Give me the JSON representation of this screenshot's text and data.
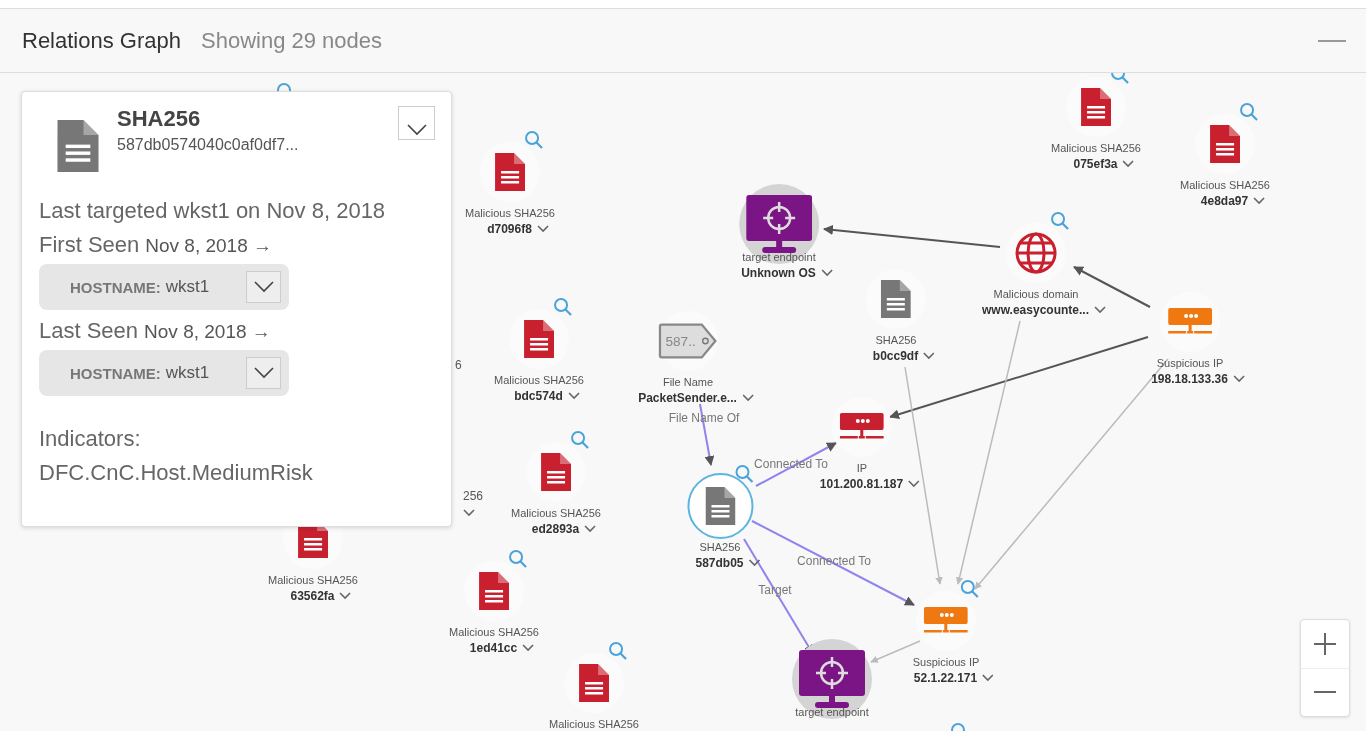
{
  "header": {
    "title": "Relations Graph",
    "subtitle": "Showing 29 nodes"
  },
  "details": {
    "type": "SHA256",
    "value": "587db0574040c0af0df7...",
    "summary": "Last targeted wkst1 on Nov 8, 2018",
    "observations": [
      {
        "label": "First Seen",
        "date": "Nov 8, 2018 →",
        "key": "HOSTNAME:",
        "value": "wkst1"
      },
      {
        "label": "Last Seen",
        "date": "Nov 8, 2018 →",
        "key": "HOSTNAME:",
        "value": "wkst1"
      }
    ],
    "indicators_label": "Indicators:",
    "indicators": "DFC.CnC.Host.MediumRisk"
  },
  "nodes": [
    {
      "kind": "malicious_file",
      "type": "Malicious SHA256",
      "value": "d7096f8",
      "search": true,
      "selected": false
    },
    {
      "kind": "malicious_file",
      "type": "Malicious SHA256",
      "value": "bdc574d",
      "search": true,
      "selected": false
    },
    {
      "kind": "malicious_file",
      "type": "Malicious SHA256",
      "value": "ed2893a",
      "search": true,
      "selected": false
    },
    {
      "kind": "malicious_file",
      "type": "Malicious SHA256",
      "value": "63562fa",
      "search": false,
      "selected": false
    },
    {
      "kind": "malicious_file",
      "type": "Malicious SHA256",
      "value": "1ed41cc",
      "search": true,
      "selected": false
    },
    {
      "kind": "malicious_file",
      "type": "Malicious SHA256",
      "search": true,
      "selected": false
    },
    {
      "kind": "malicious_file",
      "type": "Malicious SHA256",
      "value": "075ef3a",
      "search": true,
      "selected": false
    },
    {
      "kind": "malicious_file",
      "type": "Malicious SHA256",
      "value": "4e8da97",
      "search": true,
      "selected": false
    },
    {
      "kind": "endpoint",
      "type": "target endpoint",
      "value": "Unknown OS",
      "search": false,
      "selected": false
    },
    {
      "kind": "file_name",
      "tag": "587..",
      "type": "File Name",
      "value": "PacketSender.e...",
      "search": false,
      "selected": false
    },
    {
      "kind": "file",
      "type": "SHA256",
      "value": "b0cc9df",
      "search": false,
      "selected": false
    },
    {
      "kind": "domain",
      "type": "Malicious domain",
      "value": "www.easycounte...",
      "search": true,
      "selected": false
    },
    {
      "kind": "suspicious_ip",
      "type": "Suspicious IP",
      "value": "198.18.133.36",
      "search": false,
      "selected": false
    },
    {
      "kind": "ip",
      "type": "IP",
      "value": "101.200.81.187",
      "search": false,
      "selected": false
    },
    {
      "kind": "file",
      "type": "SHA256",
      "value": "587db05",
      "search": true,
      "selected": true
    },
    {
      "kind": "suspicious_ip",
      "type": "Suspicious IP",
      "value": "52.1.22.171",
      "search": true,
      "selected": false
    },
    {
      "kind": "endpoint",
      "type": "target endpoint",
      "search": false,
      "selected": false
    }
  ],
  "clipped_labels": [
    {
      "text": "6",
      "chevron": false
    },
    {
      "text": "256",
      "chevron": true
    }
  ],
  "edges": [
    {
      "kind": "strong"
    },
    {
      "kind": "strong"
    },
    {
      "kind": "strong"
    },
    {
      "kind": "weak"
    },
    {
      "kind": "weak"
    },
    {
      "kind": "weak"
    },
    {
      "kind": "relation",
      "label": "File Name Of"
    },
    {
      "kind": "relation",
      "label": "Connected To"
    },
    {
      "kind": "relation",
      "label": "Connected To"
    },
    {
      "kind": "relation",
      "label": "Target"
    },
    {
      "kind": "weak"
    }
  ]
}
